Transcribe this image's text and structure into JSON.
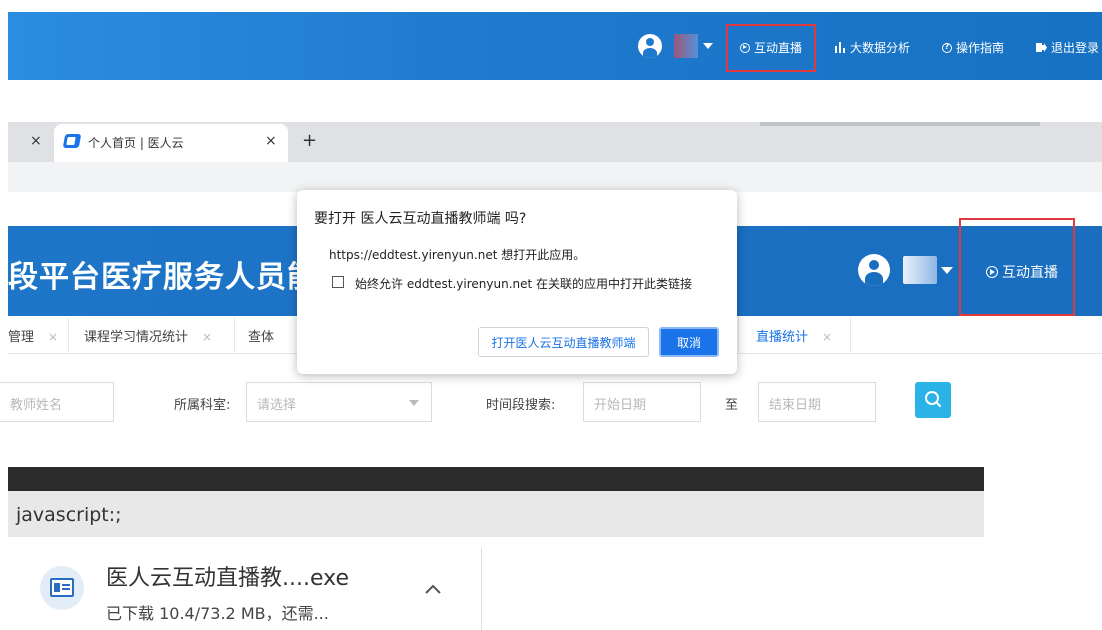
{
  "top_header": {
    "nav": {
      "live": "互动直播",
      "big_data": "大数据分析",
      "guide": "操作指南",
      "logout": "退出登录"
    }
  },
  "browser": {
    "tab_title": "个人首页 | 医人云",
    "close_glyph": "×",
    "new_tab_glyph": "+"
  },
  "app": {
    "title": "段平台医疗服务人员能力",
    "live_label": "互动直播",
    "sub_tabs": [
      {
        "label": "管理"
      },
      {
        "label": "课程学习情况统计"
      },
      {
        "label": "查体"
      },
      {
        "label": "直播统计"
      }
    ],
    "tab_close_glyph": "×",
    "filters": {
      "teacher_placeholder": "教师姓名",
      "dept_label": "所属科室:",
      "dept_placeholder": "请选择",
      "period_label": "时间段搜索:",
      "start_placeholder": "开始日期",
      "to_label": "至",
      "end_placeholder": "结束日期"
    }
  },
  "dialog": {
    "title": "要打开 医人云互动直播教师端 吗?",
    "message": "https://eddtest.yirenyun.net 想打开此应用。",
    "checkbox_label": "始终允许 eddtest.yirenyun.net 在关联的应用中打开此类链接",
    "checkbox_checked": false,
    "open_button": "打开医人云互动直播教师端",
    "cancel_button": "取消"
  },
  "download": {
    "status_url": "javascript:;",
    "filename": "医人云互动直播教....exe",
    "progress_text": "已下载 10.4/73.2 MB，还需...",
    "expand_glyph": "^"
  },
  "colors": {
    "header_blue": "#1f79cd",
    "highlight_red": "#e0393e",
    "primary_button": "#1a73e8",
    "search_button": "#2bb3e8"
  },
  "icons": {
    "live": "play-circle-icon",
    "big_data": "bar-chart-icon",
    "guide": "question-circle-icon",
    "logout": "logout-icon"
  }
}
